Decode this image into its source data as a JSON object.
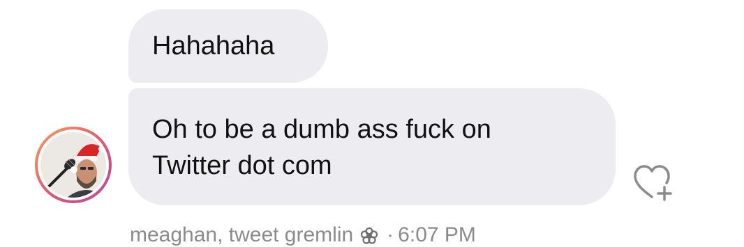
{
  "messages": [
    {
      "text": "Hahahaha"
    },
    {
      "lines": [
        "Oh to be a dumb ass fuck on",
        "Twitter dot com"
      ]
    }
  ],
  "sender": {
    "name": "meaghan, tweet gremlin",
    "badge_icon": "flower-icon"
  },
  "timestamp": {
    "separator": "·",
    "time": "6:07 PM"
  },
  "reaction": {
    "icon": "add-reaction-heart-icon"
  },
  "colors": {
    "bubble": "#ededf1",
    "meta_text": "#8b8b8f",
    "avatar_ring_start": "#f4a15a",
    "avatar_ring_end": "#b24aa3"
  }
}
